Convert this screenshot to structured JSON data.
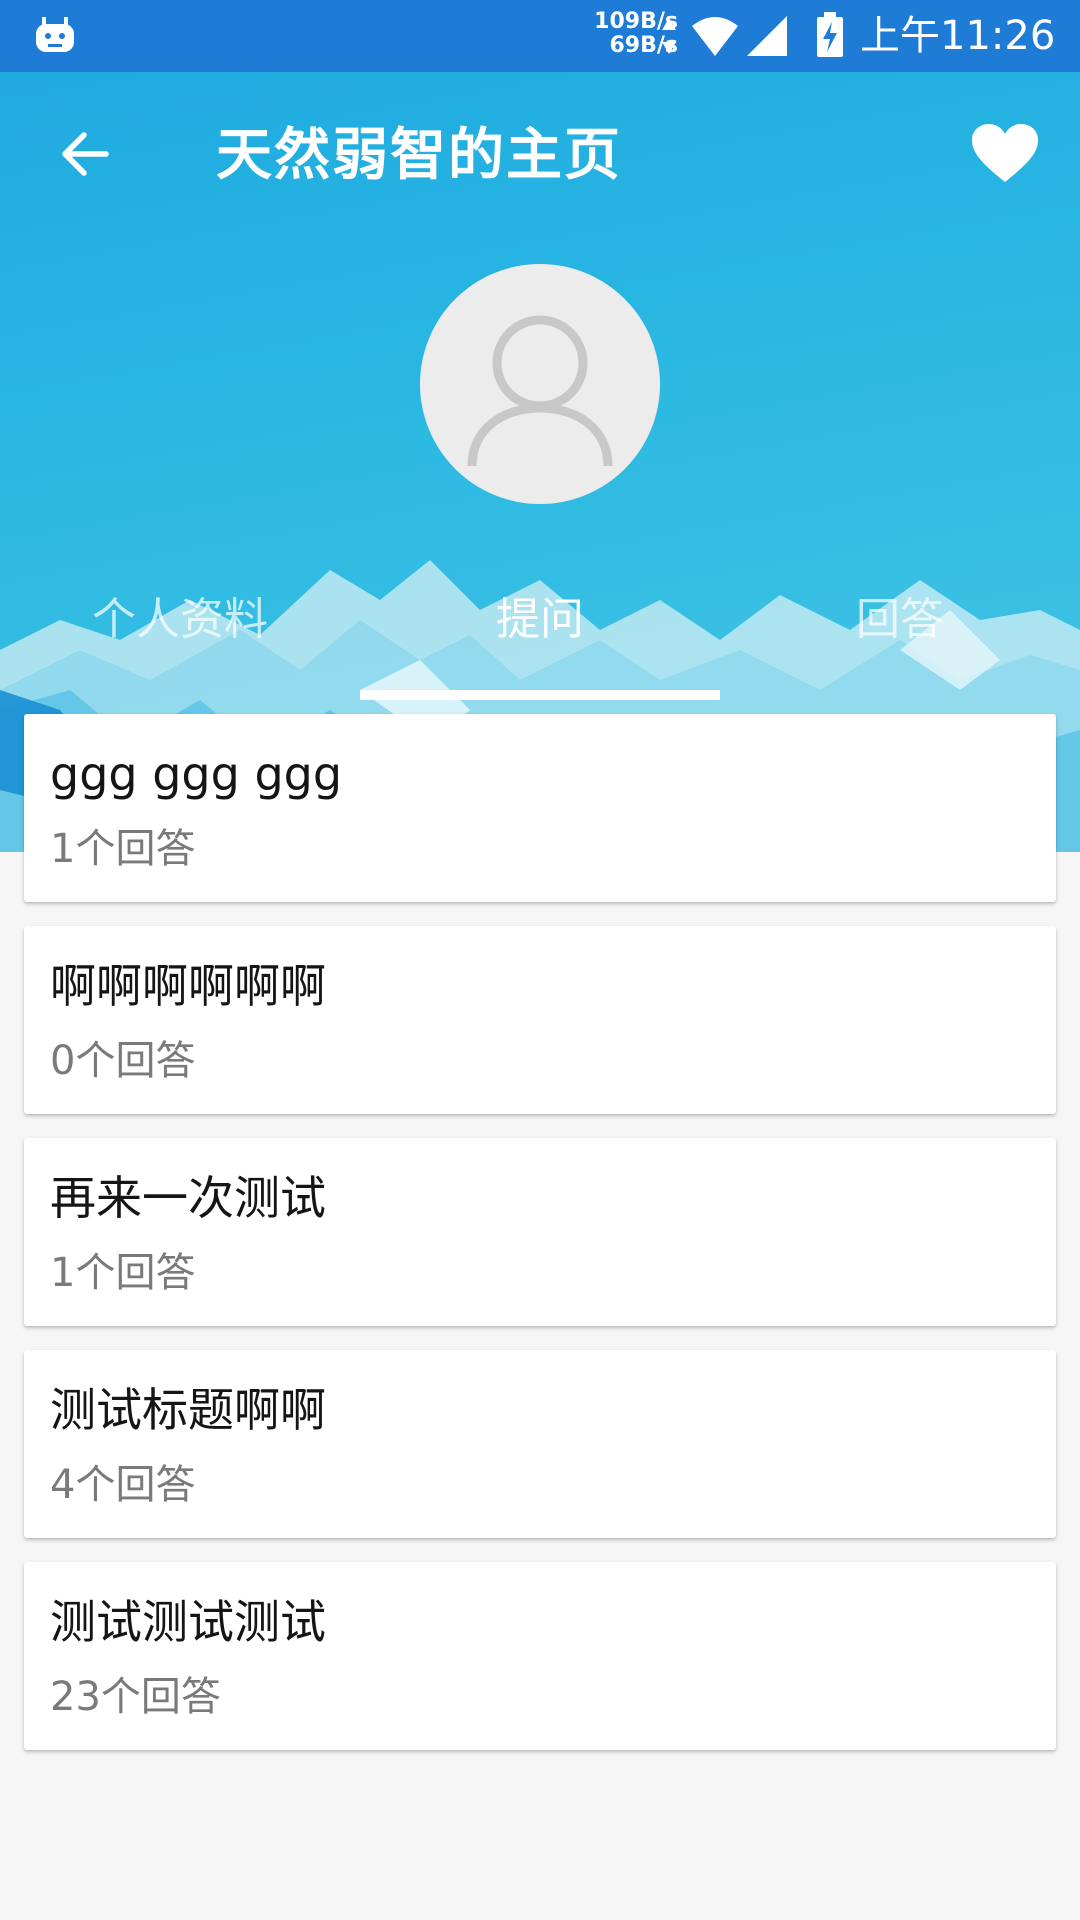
{
  "status_bar": {
    "net_up": "109B/s",
    "net_down": "69B/s",
    "time": "上午11:26",
    "icons": [
      "app-notification-icon",
      "wifi-icon",
      "signal-icon",
      "battery-charging-icon"
    ]
  },
  "toolbar": {
    "title": "天然弱智的主页",
    "back_icon": "arrow-left",
    "favorite_icon": "heart"
  },
  "tabs": [
    {
      "label": "个人资料",
      "active": false
    },
    {
      "label": "提问",
      "active": true
    },
    {
      "label": "回答",
      "active": false
    }
  ],
  "questions": [
    {
      "title": "ggg ggg ggg",
      "count": "1个回答"
    },
    {
      "title": "啊啊啊啊啊啊",
      "count": "0个回答"
    },
    {
      "title": "再来一次测试",
      "count": "1个回答"
    },
    {
      "title": "测试标题啊啊",
      "count": "4个回答"
    },
    {
      "title": "测试测试测试",
      "count": "23个回答"
    }
  ],
  "colors": {
    "status_bar": "#1e7bd6",
    "header_gradient_start": "#1ea7e0",
    "header_gradient_end": "#46c6e4",
    "background": "#f6f6f6",
    "count_text": "#7a7a7a"
  }
}
